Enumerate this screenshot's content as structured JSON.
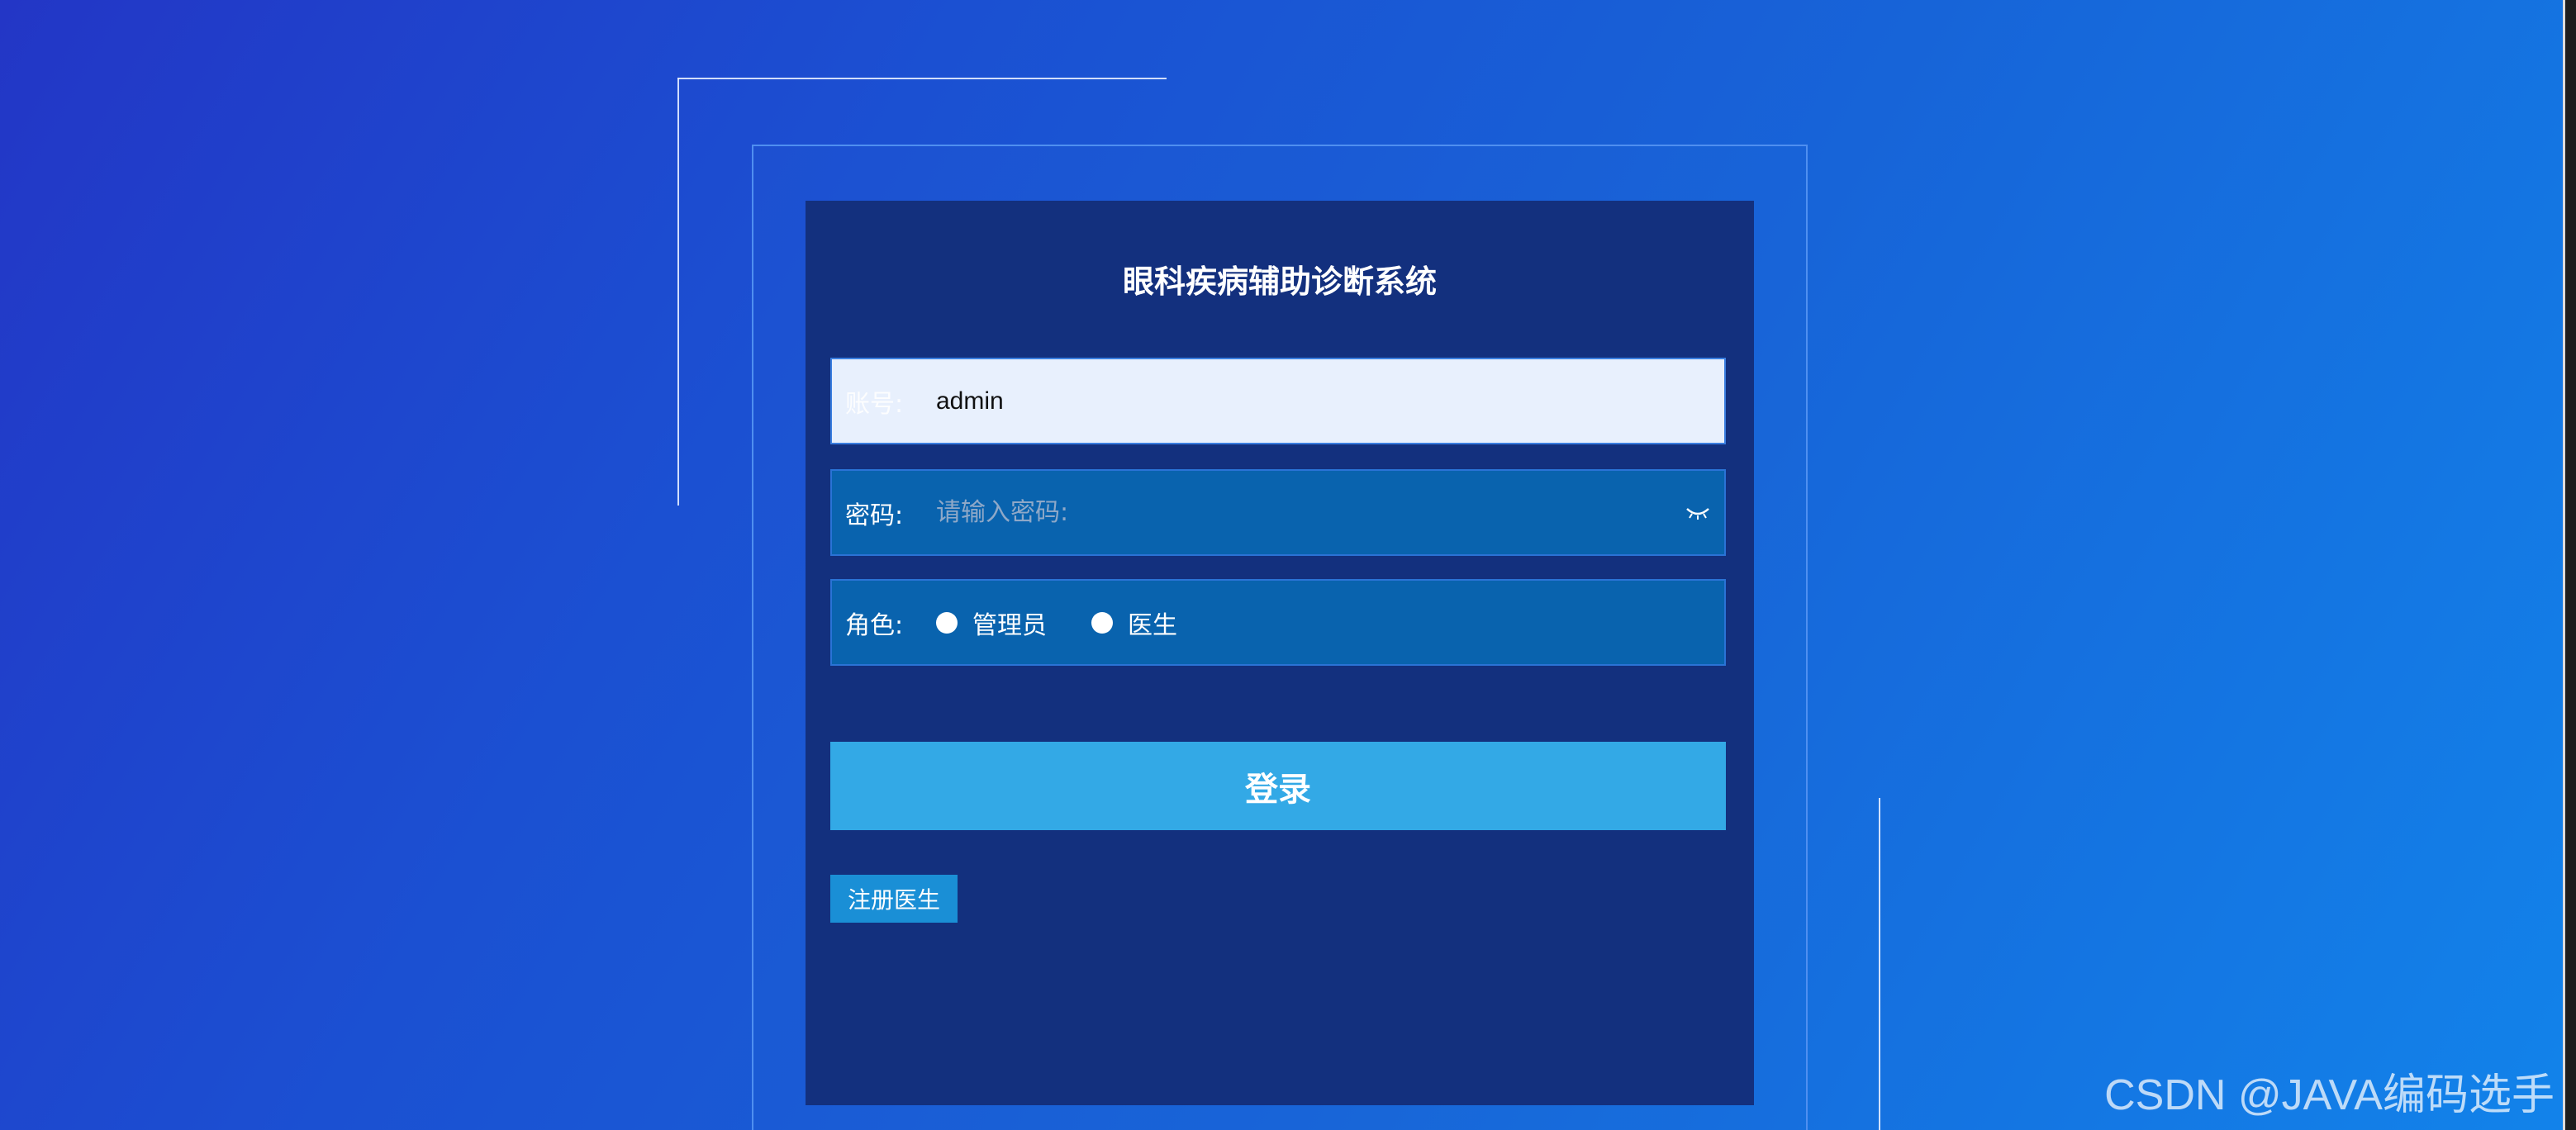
{
  "page": {
    "title": "眼科疾病辅助诊断系统"
  },
  "form": {
    "account": {
      "label": "账号:",
      "value": "admin"
    },
    "password": {
      "label": "密码:",
      "placeholder": "请输入密码:"
    },
    "role": {
      "label": "角色:",
      "options": [
        {
          "label": "管理员",
          "selected": false
        },
        {
          "label": "医生",
          "selected": false
        }
      ]
    },
    "login_label": "登录",
    "register_label": "注册医生"
  },
  "watermark": "CSDN @JAVA编码选手",
  "colors": {
    "panel": "#13307e",
    "field": "#0963ae",
    "login_button": "#33a9e6",
    "register_button": "#1a8fd6"
  }
}
